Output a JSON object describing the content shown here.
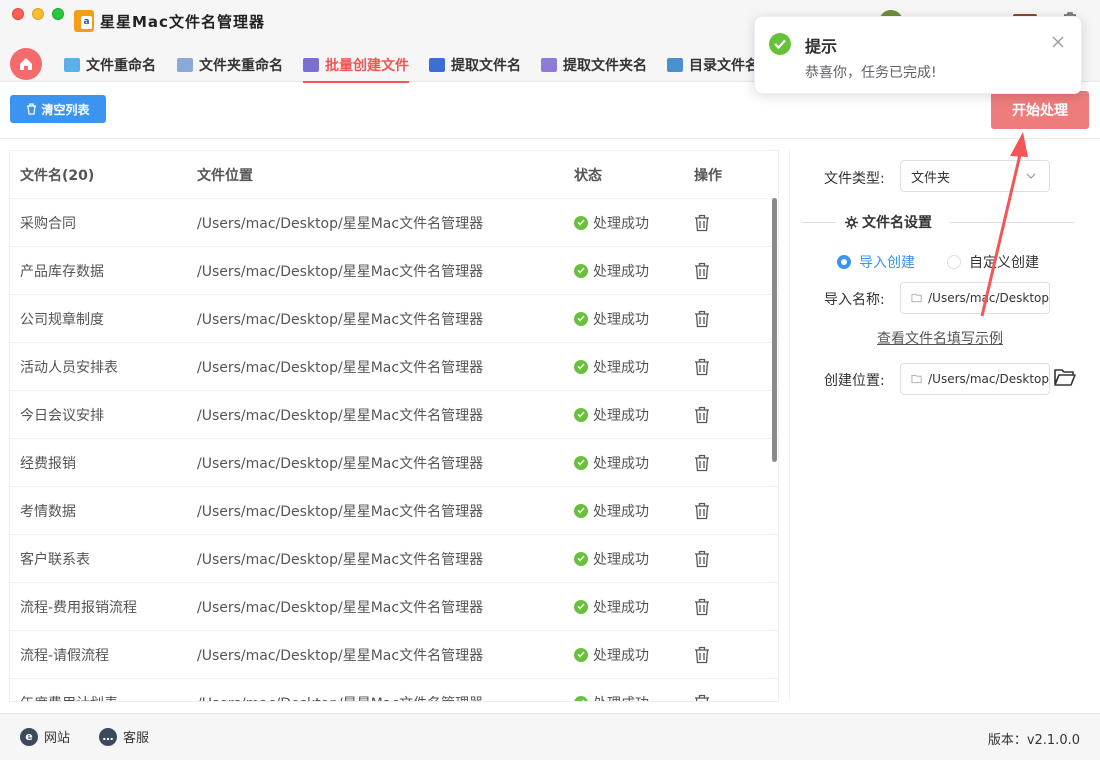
{
  "window": {
    "title": "星星Mac文件名管理器",
    "app_logo_letter": "a"
  },
  "tabs": [
    {
      "label": "文件重命名",
      "active": false,
      "color": "#5ab0e8"
    },
    {
      "label": "文件夹重命名",
      "active": false,
      "color": "#8aa8d8"
    },
    {
      "label": "批量创建文件",
      "active": true,
      "color": "#7b6fd6"
    },
    {
      "label": "提取文件名",
      "active": false,
      "color": "#3b6fd6"
    },
    {
      "label": "提取文件夹名",
      "active": false,
      "color": "#8e7bd8"
    },
    {
      "label": "目录文件名",
      "active": false,
      "color": "#4a8fd0"
    }
  ],
  "toolbar": {
    "clear_label": "清空列表",
    "start_label": "开始处理"
  },
  "table": {
    "headers": {
      "name": "文件名(20)",
      "location": "文件位置",
      "status": "状态",
      "op": "操作"
    },
    "rows": [
      {
        "name": "采购合同",
        "location": "/Users/mac/Desktop/星星Mac文件名管理器",
        "status": "处理成功"
      },
      {
        "name": "产品库存数据",
        "location": "/Users/mac/Desktop/星星Mac文件名管理器",
        "status": "处理成功"
      },
      {
        "name": "公司规章制度",
        "location": "/Users/mac/Desktop/星星Mac文件名管理器",
        "status": "处理成功"
      },
      {
        "name": "活动人员安排表",
        "location": "/Users/mac/Desktop/星星Mac文件名管理器",
        "status": "处理成功"
      },
      {
        "name": "今日会议安排",
        "location": "/Users/mac/Desktop/星星Mac文件名管理器",
        "status": "处理成功"
      },
      {
        "name": "经费报销",
        "location": "/Users/mac/Desktop/星星Mac文件名管理器",
        "status": "处理成功"
      },
      {
        "name": "考情数据",
        "location": "/Users/mac/Desktop/星星Mac文件名管理器",
        "status": "处理成功"
      },
      {
        "name": "客户联系表",
        "location": "/Users/mac/Desktop/星星Mac文件名管理器",
        "status": "处理成功"
      },
      {
        "name": "流程-费用报销流程",
        "location": "/Users/mac/Desktop/星星Mac文件名管理器",
        "status": "处理成功"
      },
      {
        "name": "流程-请假流程",
        "location": "/Users/mac/Desktop/星星Mac文件名管理器",
        "status": "处理成功"
      },
      {
        "name": "年度费用计划表",
        "location": "/Users/mac/Desktop/星星Mac文件名管理器",
        "status": "处理成功"
      }
    ]
  },
  "settings": {
    "file_type_label": "文件类型:",
    "file_type_value": "文件夹",
    "section_title": "文件名设置",
    "radio_import": "导入创建",
    "radio_custom": "自定义创建",
    "import_label": "导入名称:",
    "import_value": "/Users/mac/Desktop",
    "example_link": "查看文件名填写示例",
    "create_label": "创建位置:",
    "create_value": "/Users/mac/Desktop"
  },
  "footer": {
    "website": "网站",
    "support": "客服",
    "version": "版本：v2.1.0.0"
  },
  "toast": {
    "title": "提示",
    "message": "恭喜你，任务已完成!"
  },
  "colors": {
    "accent": "#f25656",
    "primary": "#3b95f0",
    "success": "#67c23a",
    "start_button": "#ee7c7c"
  }
}
